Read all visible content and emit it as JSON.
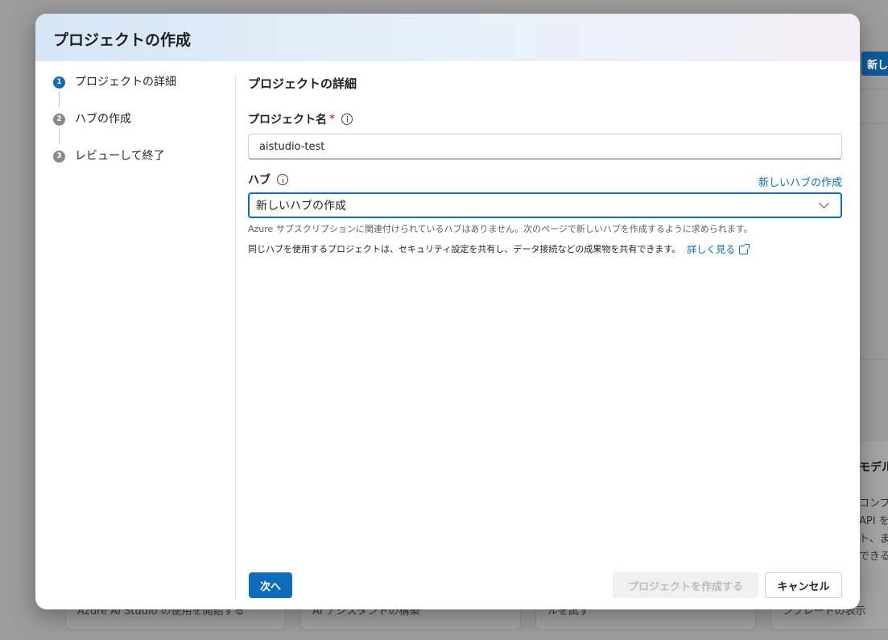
{
  "background": {
    "new_button_label": "新し",
    "cards": [
      {
        "text": "Azure AI Studio の使用を開始する"
      },
      {
        "text": "AI アシスタントの構築"
      },
      {
        "text": "ルを試す"
      },
      {
        "text": "ンプレートの表示"
      }
    ],
    "right_panel": {
      "title": "モデル",
      "lines": [
        "コンプ",
        "API を",
        "ト、ま",
        "できる"
      ]
    }
  },
  "modal": {
    "title": "プロジェクトの作成",
    "steps": [
      {
        "number": "1",
        "label": "プロジェクトの詳細",
        "active": true
      },
      {
        "number": "2",
        "label": "ハブの作成",
        "active": false
      },
      {
        "number": "3",
        "label": "レビューして終了",
        "active": false
      }
    ],
    "section_title": "プロジェクトの詳細",
    "project_name": {
      "label": "プロジェクト名",
      "required_mark": "*",
      "value": "aistudio-test"
    },
    "hub": {
      "label": "ハブ",
      "new_hub_link": "新しいハブの作成",
      "selected_value": "新しいハブの作成",
      "hint": "Azure サブスクリプションに関連付けられているハブはありません。次のページで新しいハブを作成するように求められます。",
      "description": "同じハブを使用するプロジェクトは、セキュリティ設定を共有し、データ接続などの成果物を共有できます。",
      "learn_more_link": "詳しく見る"
    },
    "buttons": {
      "next": "次へ",
      "create_project": "プロジェクトを作成する",
      "cancel": "キャンセル"
    }
  },
  "colors": {
    "accent": "#0f6cbd",
    "required": "#c50f1f",
    "disabled_text": "#bdbdbd"
  }
}
